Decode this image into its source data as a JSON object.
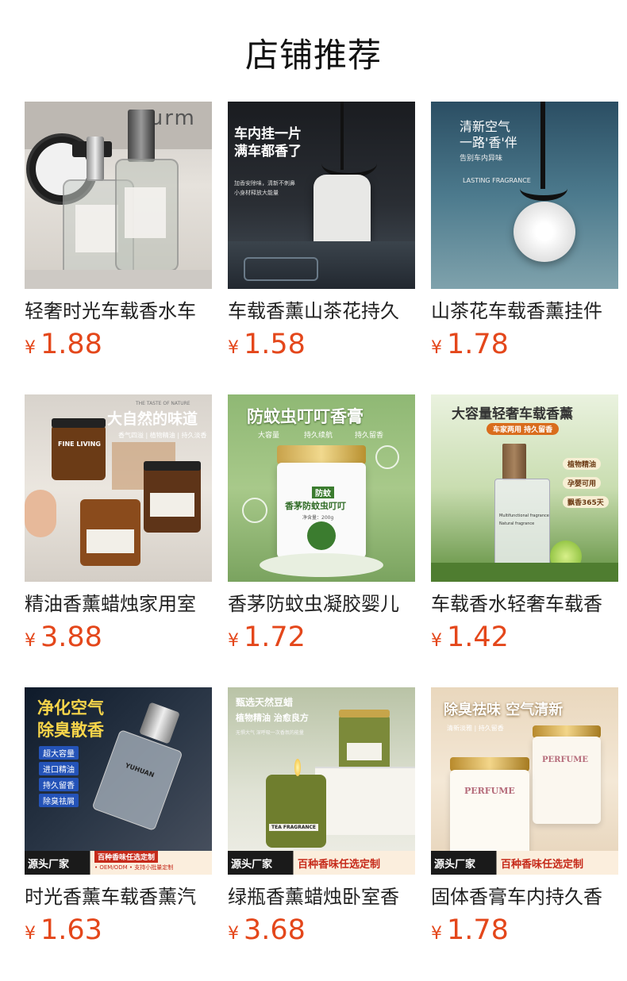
{
  "header": {
    "title": "店铺推荐"
  },
  "currency": "¥",
  "products": [
    {
      "name": "轻奢时光车载香水车",
      "price": "1.88",
      "image": {
        "texts": {
          "label1": "sturm"
        }
      }
    },
    {
      "name": "车载香薰山茶花持久",
      "price": "1.58",
      "image": {
        "texts": {
          "headline1": "车内挂一片",
          "headline2": "满车都香了",
          "sub1": "加香安除味，清新不刺鼻",
          "sub2": "小身材释放大能量"
        }
      }
    },
    {
      "name": "山茶花车载香薰挂件",
      "price": "1.78",
      "image": {
        "texts": {
          "headline1": "清新空气",
          "headline2": "一路'香'伴",
          "sub1": "告别车内异味",
          "sub2": "LASTING FRAGRANCE"
        }
      }
    },
    {
      "name": "精油香薰蜡烛家用室",
      "price": "3.88",
      "image": {
        "texts": {
          "small": "THE TASTE OF NATURE",
          "headline1": "大自然的味道",
          "tags": "香气四溢 | 植物精油 | 持久淡香",
          "jar": "FINE LIVING"
        }
      }
    },
    {
      "name": "香茅防蚊虫凝胶婴儿",
      "price": "1.72",
      "image": {
        "texts": {
          "headline1": "防蚊虫叮叮香膏",
          "tag1": "大容量",
          "tag2": "持久续航",
          "tag3": "持久留香",
          "jar_top": "防蚊",
          "jar_title": "香茅防蚊虫叮叮",
          "jar_small": "净含量：200g"
        }
      }
    },
    {
      "name": "车载香水轻奢车载香",
      "price": "1.42",
      "image": {
        "texts": {
          "headline1": "大容量轻奢车载香薰",
          "ribbon": "车家两用 持久留香",
          "tag1": "植物精油",
          "tag2": "孕婴可用",
          "tag3": "飘香365天",
          "bottle1": "Multifunctional fragrance",
          "bottle2": "Natural fragrance"
        }
      }
    },
    {
      "name": "时光香薰车载香薰汽",
      "price": "1.63",
      "image": {
        "texts": {
          "headline1": "净化空气",
          "headline2": "除臭散香",
          "tag1": "超大容量",
          "tag2": "进口精油",
          "tag3": "持久留香",
          "tag4": "除臭祛屑",
          "brand": "源头厂家",
          "banner1": "百种香味任选定制",
          "banner2": "• OEM/ODM • 支持小批量定制",
          "bottle": "YUHUAN"
        }
      }
    },
    {
      "name": "绿瓶香薰蜡烛卧室香",
      "price": "3.68",
      "image": {
        "texts": {
          "headline1": "甄选天然豆蜡",
          "headline2": "植物精油 治愈良方",
          "sub1": "无惧大气  深呼吸一次香氛的能量",
          "jar": "TEA FRAGRANCE",
          "brand": "源头厂家",
          "banner1": "百种香味任选定制"
        }
      }
    },
    {
      "name": "固体香膏车内持久香",
      "price": "1.78",
      "image": {
        "texts": {
          "headline1": "除臭祛味 空气清新",
          "sub1": "清新淡雅 | 持久留香",
          "jar": "PERFUME",
          "brand": "源头厂家",
          "banner1": "百种香味任选定制"
        }
      }
    }
  ],
  "colors": {
    "price": "#e4471b",
    "title": "#111111",
    "name": "#222222"
  }
}
